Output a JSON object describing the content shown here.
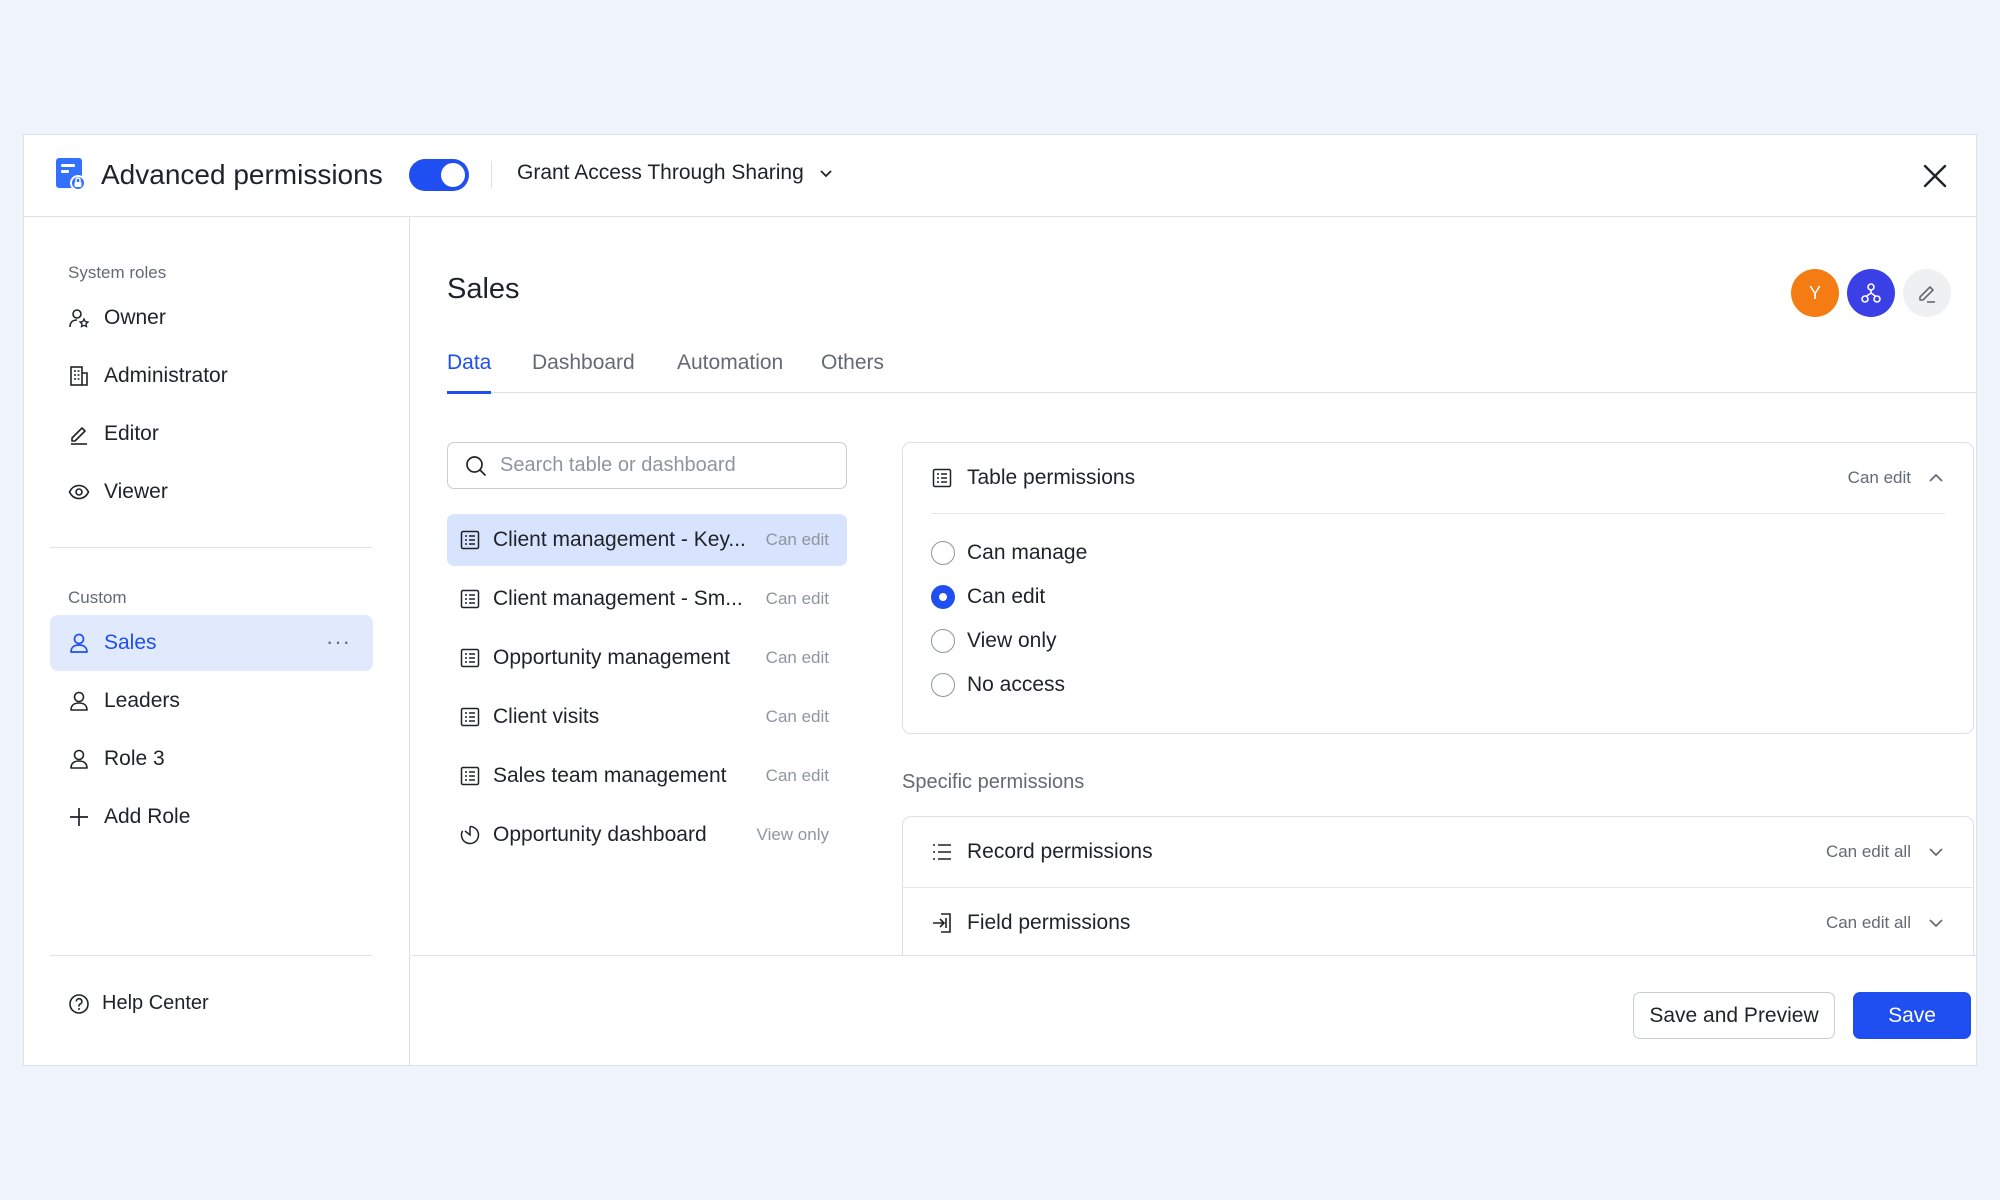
{
  "header": {
    "title": "Advanced permissions",
    "toggle_on": true,
    "grant_label": "Grant Access Through Sharing",
    "accent_color": "#1f4ff0"
  },
  "sidebar": {
    "system_roles_label": "System roles",
    "system_roles": [
      {
        "label": "Owner",
        "icon": "owner-icon"
      },
      {
        "label": "Administrator",
        "icon": "building-icon"
      },
      {
        "label": "Editor",
        "icon": "pencil-icon"
      },
      {
        "label": "Viewer",
        "icon": "eye-icon"
      }
    ],
    "custom_label": "Custom",
    "custom_roles": [
      {
        "label": "Sales",
        "icon": "user-icon",
        "active": true
      },
      {
        "label": "Leaders",
        "icon": "user-icon"
      },
      {
        "label": "Role 3",
        "icon": "user-icon"
      }
    ],
    "add_role_label": "Add Role",
    "help_label": "Help Center"
  },
  "main": {
    "role_title": "Sales",
    "avatar_letter": "Y",
    "tabs": [
      {
        "label": "Data",
        "active": true
      },
      {
        "label": "Dashboard"
      },
      {
        "label": "Automation"
      },
      {
        "label": "Others"
      }
    ],
    "search_placeholder": "Search table or dashboard",
    "tables": [
      {
        "name": "Client management - Key...",
        "perm": "Can edit",
        "icon": "table-icon",
        "active": true
      },
      {
        "name": "Client management - Sm...",
        "perm": "Can edit",
        "icon": "table-icon"
      },
      {
        "name": "Opportunity management",
        "perm": "Can edit",
        "icon": "table-icon"
      },
      {
        "name": "Client visits",
        "perm": "Can edit",
        "icon": "table-icon"
      },
      {
        "name": "Sales team management",
        "perm": "Can edit",
        "icon": "table-icon"
      },
      {
        "name": "Opportunity dashboard",
        "perm": "View only",
        "icon": "dashboard-icon"
      }
    ],
    "table_permissions": {
      "title": "Table permissions",
      "value": "Can edit",
      "options": [
        {
          "label": "Can manage",
          "checked": false
        },
        {
          "label": "Can edit",
          "checked": true
        },
        {
          "label": "View only",
          "checked": false
        },
        {
          "label": "No access",
          "checked": false
        }
      ]
    },
    "specific_label": "Specific permissions",
    "specific": [
      {
        "title": "Record permissions",
        "value": "Can edit all",
        "icon": "list-icon"
      },
      {
        "title": "Field permissions",
        "value": "Can edit all",
        "icon": "field-icon"
      }
    ]
  },
  "footer": {
    "save_preview_label": "Save and Preview",
    "save_label": "Save"
  }
}
